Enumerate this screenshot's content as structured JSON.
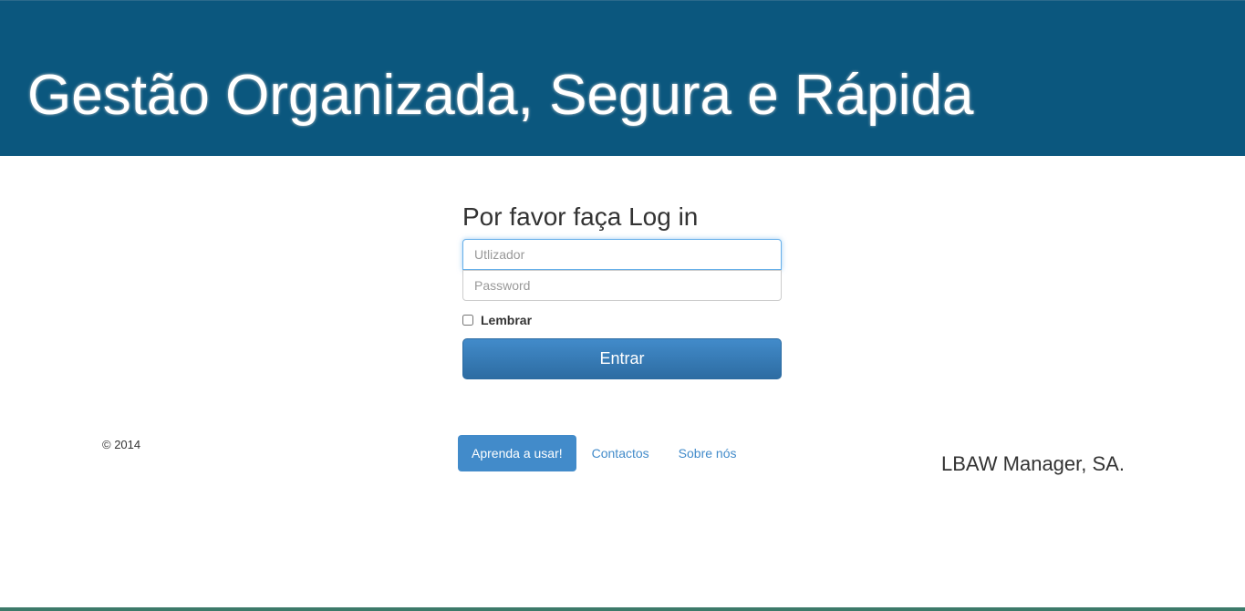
{
  "header": {
    "title": "Gestão Organizada, Segura e Rápida"
  },
  "login": {
    "heading": "Por favor faça Log in",
    "username_placeholder": "Utlizador",
    "password_placeholder": "Password",
    "remember_label": "Lembrar",
    "submit_label": "Entrar"
  },
  "footer": {
    "copyright": "© 2014",
    "nav": [
      {
        "label": "Aprenda a usar!",
        "active": true
      },
      {
        "label": "Contactos"
      },
      {
        "label": "Sobre nós"
      }
    ],
    "company": "LBAW Manager, SA."
  },
  "colors": {
    "header_bg": "#0b577e",
    "primary": "#428bca"
  }
}
